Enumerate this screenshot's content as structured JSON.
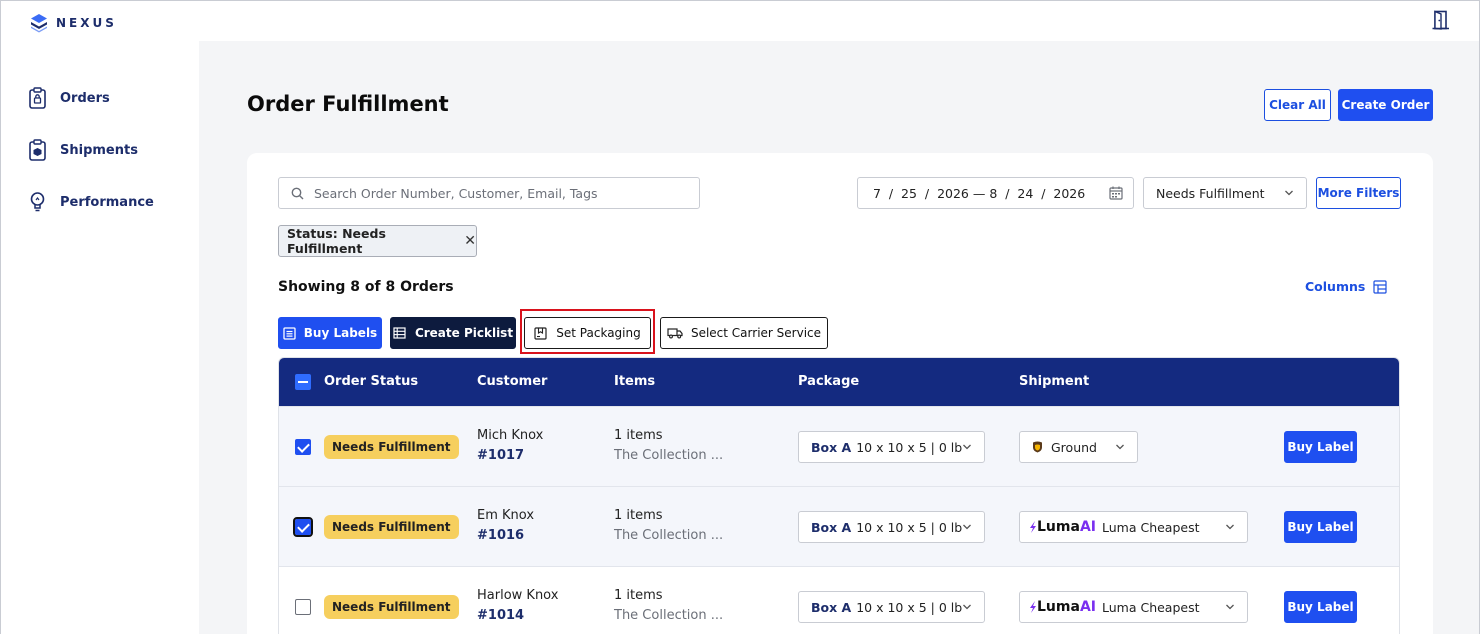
{
  "app": {
    "brand": "NEXUS"
  },
  "sidebar": {
    "items": [
      {
        "label": "Orders",
        "icon": "clipboard-lock-icon"
      },
      {
        "label": "Shipments",
        "icon": "clipboard-box-icon"
      },
      {
        "label": "Performance",
        "icon": "lightbulb-icon"
      }
    ]
  },
  "header": {
    "title": "Order Fulfillment",
    "clear_all": "Clear All",
    "create_order": "Create Order"
  },
  "filters": {
    "search_placeholder": "Search Order Number, Customer, Email, Tags",
    "date_range": "7  /  25  /  2026 — 8  /  24  /  2026",
    "status_select": "Needs Fulfillment",
    "more_filters": "More Filters",
    "active_chip": "Status: Needs Fulfillment"
  },
  "summary": {
    "showing": "Showing 8 of 8 Orders",
    "columns": "Columns"
  },
  "actions": {
    "buy_labels": "Buy Labels",
    "create_picklist": "Create Picklist",
    "set_packaging": "Set Packaging",
    "select_carrier": "Select Carrier Service"
  },
  "table": {
    "headers": {
      "status": "Order Status",
      "customer": "Customer",
      "items": "Items",
      "package": "Package",
      "shipment": "Shipment"
    },
    "rows": [
      {
        "checked": true,
        "status": "Needs Fulfillment",
        "customer": "Mich Knox",
        "order": "#1017",
        "items_count": "1 items",
        "items_desc": "The Collection ...",
        "package_name": "Box A",
        "package_dims": "10 x 10 x 5 | 0 lb",
        "shipment": "Ground",
        "buy": "Buy Label"
      },
      {
        "checked": true,
        "status": "Needs Fulfillment",
        "customer": "Em Knox",
        "order": "#1016",
        "items_count": "1 items",
        "items_desc": "The Collection ...",
        "package_name": "Box A",
        "package_dims": "10 x 10 x 5 | 0 lb",
        "shipment_brand": "Luma",
        "shipment_brand_ai": "AI",
        "shipment": "Luma Cheapest",
        "buy": "Buy Label"
      },
      {
        "checked": false,
        "status": "Needs Fulfillment",
        "customer": "Harlow Knox",
        "order": "#1014",
        "items_count": "1 items",
        "items_desc": "The Collection ...",
        "package_name": "Box A",
        "package_dims": "10 x 10 x 5 | 0 lb",
        "shipment_brand": "Luma",
        "shipment_brand_ai": "AI",
        "shipment": "Luma Cheapest",
        "buy": "Buy Label"
      }
    ]
  },
  "colors": {
    "primary": "#1f4ff0",
    "navy": "#0d1b3e",
    "table_header": "#142a80",
    "badge": "#f6cf5e",
    "highlight": "#d9121c"
  }
}
